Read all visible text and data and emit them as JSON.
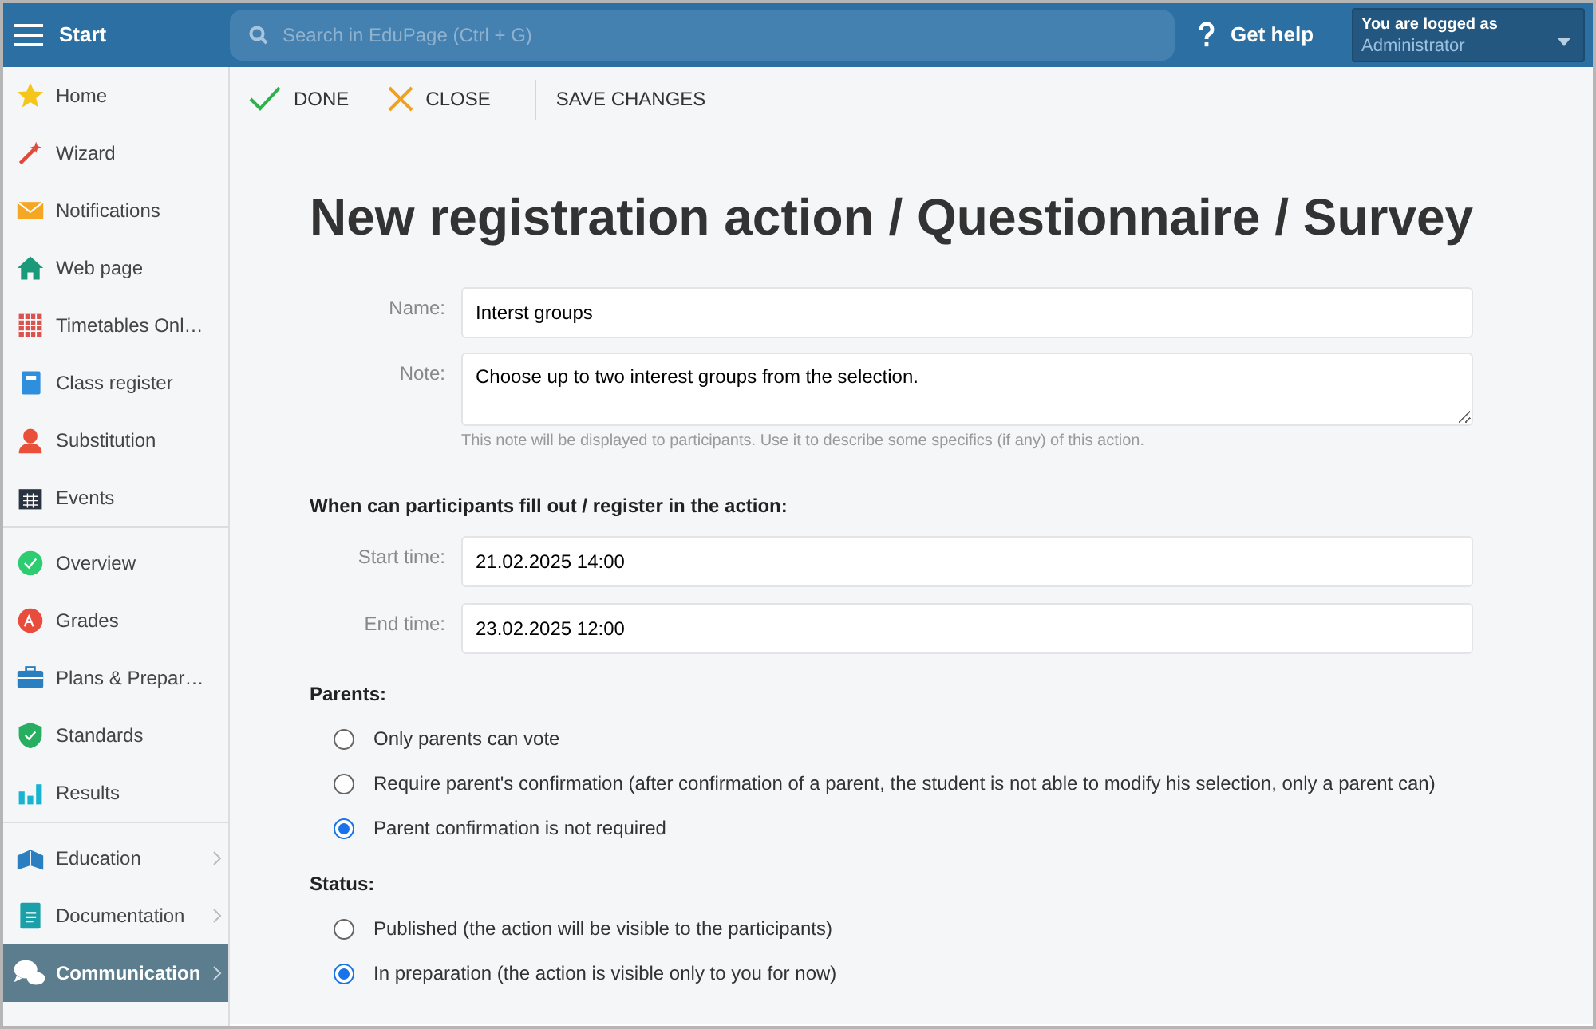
{
  "header": {
    "title": "Start",
    "search": {
      "placeholder": "Search in EduPage (Ctrl + G)"
    },
    "help": "Get help",
    "user": {
      "caption": "You are logged as",
      "role": "Administrator"
    }
  },
  "sidebar": {
    "groups": [
      [
        {
          "kind": "star",
          "label": "Home",
          "submenu": false,
          "selected": false
        },
        {
          "kind": "wand",
          "label": "Wizard",
          "submenu": false,
          "selected": false
        },
        {
          "kind": "envelope",
          "label": "Notifications",
          "submenu": false,
          "selected": false
        },
        {
          "kind": "house",
          "label": "Web page",
          "submenu": false,
          "selected": false
        },
        {
          "kind": "grid",
          "label": "Timetables Onl…",
          "submenu": false,
          "selected": false
        },
        {
          "kind": "book",
          "label": "Class register",
          "submenu": false,
          "selected": false
        },
        {
          "kind": "person",
          "label": "Substitution",
          "submenu": false,
          "selected": false
        },
        {
          "kind": "calendar",
          "label": "Events",
          "submenu": false,
          "selected": false
        }
      ],
      [
        {
          "kind": "check",
          "label": "Overview",
          "submenu": false,
          "selected": false
        },
        {
          "kind": "grade",
          "label": "Grades",
          "submenu": false,
          "selected": false
        },
        {
          "kind": "briefcase",
          "label": "Plans & Prepar…",
          "submenu": false,
          "selected": false
        },
        {
          "kind": "shield",
          "label": "Standards",
          "submenu": false,
          "selected": false
        },
        {
          "kind": "bars",
          "label": "Results",
          "submenu": false,
          "selected": false
        }
      ],
      [
        {
          "kind": "openbook",
          "label": "Education",
          "submenu": true,
          "selected": false
        },
        {
          "kind": "document",
          "label": "Documentation",
          "submenu": true,
          "selected": false
        },
        {
          "kind": "chat",
          "label": "Communication",
          "submenu": true,
          "selected": true
        }
      ]
    ]
  },
  "toolbar": [
    {
      "kind": "check",
      "label": "DONE"
    },
    {
      "kind": "cross",
      "label": "CLOSE"
    },
    {
      "kind": "plain",
      "label": "SAVE CHANGES"
    }
  ],
  "form": {
    "title": "New registration action / Questionnaire / Survey",
    "name": {
      "label": "Name:",
      "value": "Interst groups"
    },
    "note": {
      "label": "Note:",
      "value": "Choose up to two interest groups from the selection.",
      "hint": "This note will be displayed to participants. Use it to describe some specifics (if any) of this action."
    },
    "period_heading": "When can participants fill out / register in the action:",
    "start": {
      "label": "Start time:",
      "value": "21.02.2025 14:00"
    },
    "end": {
      "label": "End time:",
      "value": "23.02.2025 12:00"
    },
    "parents": {
      "heading": "Parents:",
      "options": [
        {
          "label": "Only parents can vote",
          "selected": false
        },
        {
          "label": "Require parent's confirmation (after confirmation of a parent, the student is not able to modify his selection, only a parent can)",
          "selected": false
        },
        {
          "label": "Parent confirmation is not required",
          "selected": true
        }
      ]
    },
    "status": {
      "heading": "Status:",
      "options": [
        {
          "label": "Published (the action will be visible to the participants)",
          "selected": false
        },
        {
          "label": "In preparation (the action is visible only to you for now)",
          "selected": true
        }
      ]
    }
  }
}
